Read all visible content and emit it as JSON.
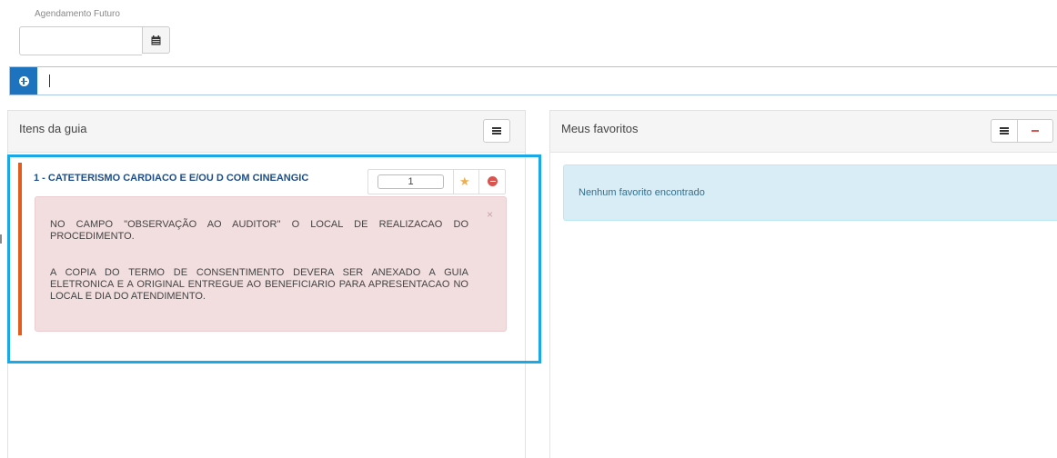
{
  "agendamento": {
    "label": "Agendamento Futuro",
    "value": ""
  },
  "search": {
    "value": ""
  },
  "left_panel": {
    "title": "Itens da guia",
    "item": {
      "title": "1 - CATETERISMO CARDIACO E E/OU D COM CINEANGIC",
      "quantity": "1",
      "close_glyph": "×",
      "alert": {
        "paragraph1": "NO CAMPO \"OBSERVAÇÃO AO AUDITOR\" O LOCAL DE REALIZACAO DO PROCEDIMENTO.",
        "paragraph2": "A COPIA DO TERMO DE CONSENTIMENTO DEVERA SER ANEXADO A GUIA ELETRONICA E A ORIGINAL ENTREGUE AO BENEFICIARIO PARA APRESENTACAO NO LOCAL E DIA DO ATENDIMENTO."
      }
    }
  },
  "right_panel": {
    "title": "Meus favoritos",
    "empty_message": "Nenhum favorito encontrado"
  },
  "colors": {
    "primary": "#1e73be",
    "highlight": "#1aa9e6",
    "item_accent": "#e35c1f",
    "alert_bg": "#f2dede",
    "info_bg": "#d9edf7",
    "danger": "#d9534f",
    "star": "#f0ad4e"
  },
  "icons": [
    "calendar-icon",
    "plus-circle-icon",
    "list-icon",
    "star-icon",
    "minus-circle-icon",
    "close-icon",
    "minus-icon"
  ]
}
